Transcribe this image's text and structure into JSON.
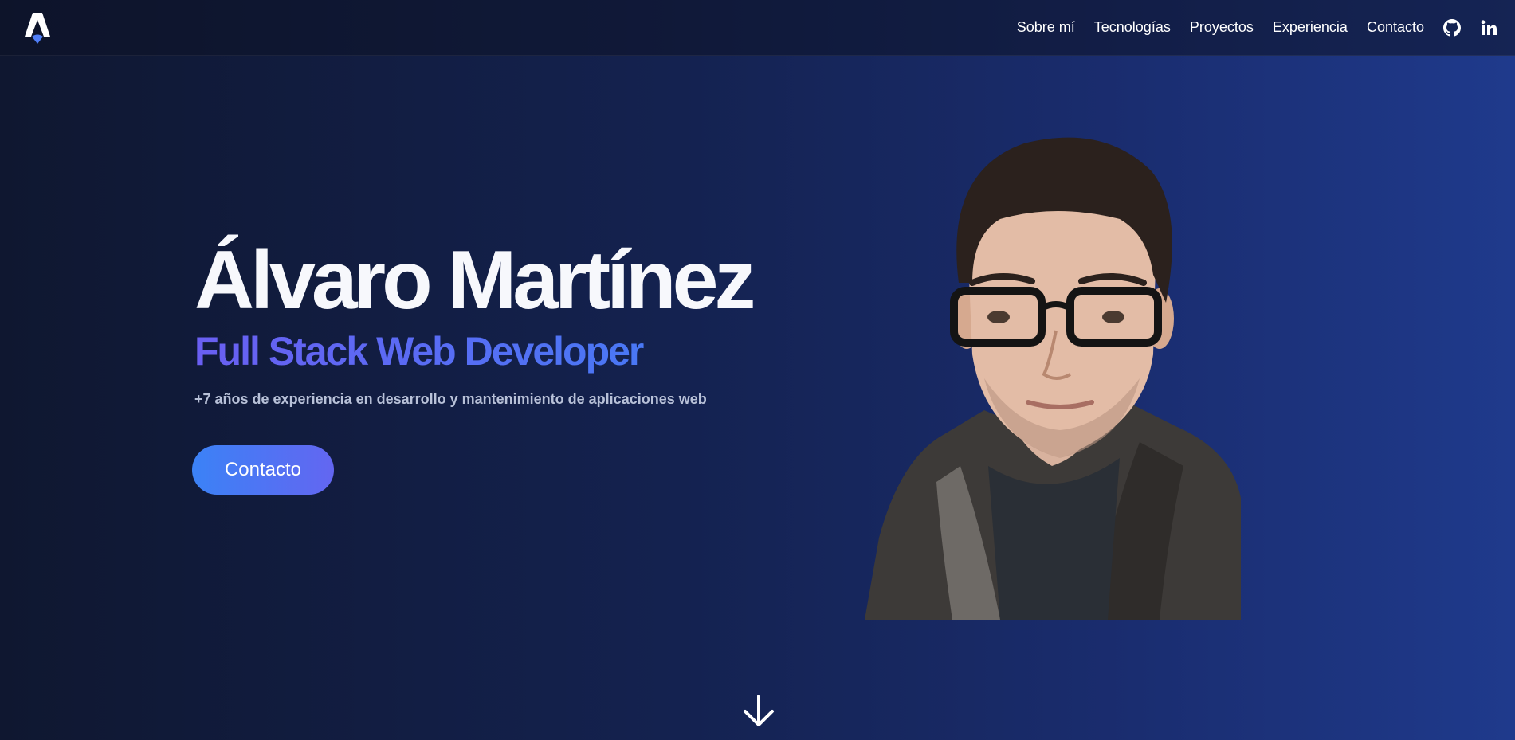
{
  "header": {
    "logo_icon": "astro-logo-icon",
    "nav": [
      {
        "label": "Sobre mí"
      },
      {
        "label": "Tecnologías"
      },
      {
        "label": "Proyectos"
      },
      {
        "label": "Experiencia"
      },
      {
        "label": "Contacto"
      }
    ],
    "social_icons": [
      "github-icon",
      "linkedin-icon"
    ]
  },
  "hero": {
    "name": "Álvaro Martínez",
    "role": "Full Stack Web Developer",
    "subtitle": "+7 años de experiencia en desarrollo y mantenimiento de aplicaciones web",
    "cta_label": "Contacto",
    "scroll_icon": "arrow-down-icon"
  },
  "colors": {
    "background_start": "#0f1730",
    "background_end": "#1f3a8c",
    "accent_blue": "#3b82f6",
    "accent_violet": "#6366f1",
    "subtitle_gray": "#b8c1d8"
  }
}
